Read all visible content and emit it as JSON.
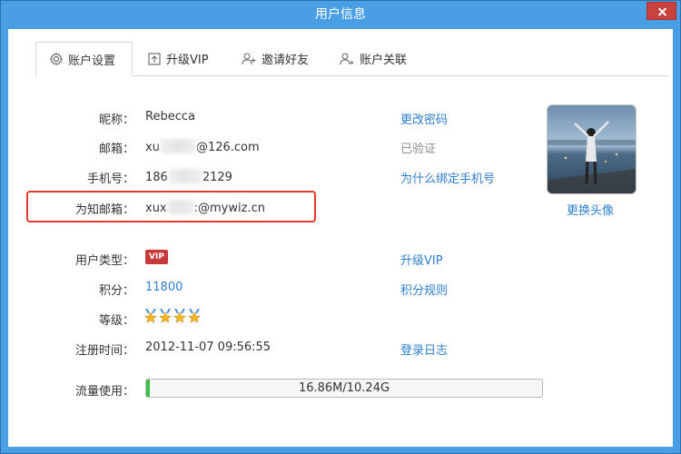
{
  "window": {
    "title": "用户信息"
  },
  "tabs": [
    {
      "label": "账户设置",
      "icon": "gear-icon"
    },
    {
      "label": "升级VIP",
      "icon": "upload-icon"
    },
    {
      "label": "邀请好友",
      "icon": "add-user-icon"
    },
    {
      "label": "账户关联",
      "icon": "link-user-icon"
    }
  ],
  "profile": {
    "nickname_label": "昵称：",
    "nickname": "Rebecca",
    "email_label": "邮箱：",
    "email_prefix": "xu",
    "email_suffix": "@126.com",
    "phone_label": "手机号：",
    "phone_prefix": "186",
    "phone_suffix": "2129",
    "wiz_email_label": "为知邮箱：",
    "wiz_email_prefix": "xux",
    "wiz_email_suffix": ":@mywiz.cn",
    "user_type_label": "用户类型：",
    "user_type_badge": "VIP",
    "points_label": "积分：",
    "points": "11800",
    "level_label": "等级：",
    "level_stars": 4,
    "register_label": "注册时间：",
    "register_time": "2012-11-07 09:56:55",
    "traffic_label": "流量使用：",
    "traffic_text": "16.86M/10.24G",
    "traffic_fraction": 0.0016
  },
  "actions": {
    "change_password": "更改密码",
    "email_verified": "已验证",
    "why_bind_phone": "为什么绑定手机号",
    "change_avatar": "更换头像",
    "upgrade_vip": "升级VIP",
    "points_rules": "积分规则",
    "login_log": "登录日志"
  },
  "colors": {
    "accent": "#2f7fd1",
    "titlebar": "#4a9ee3",
    "highlight": "#e53a2b",
    "vip": "#c83a3a",
    "progress": "#3fbf4a"
  }
}
